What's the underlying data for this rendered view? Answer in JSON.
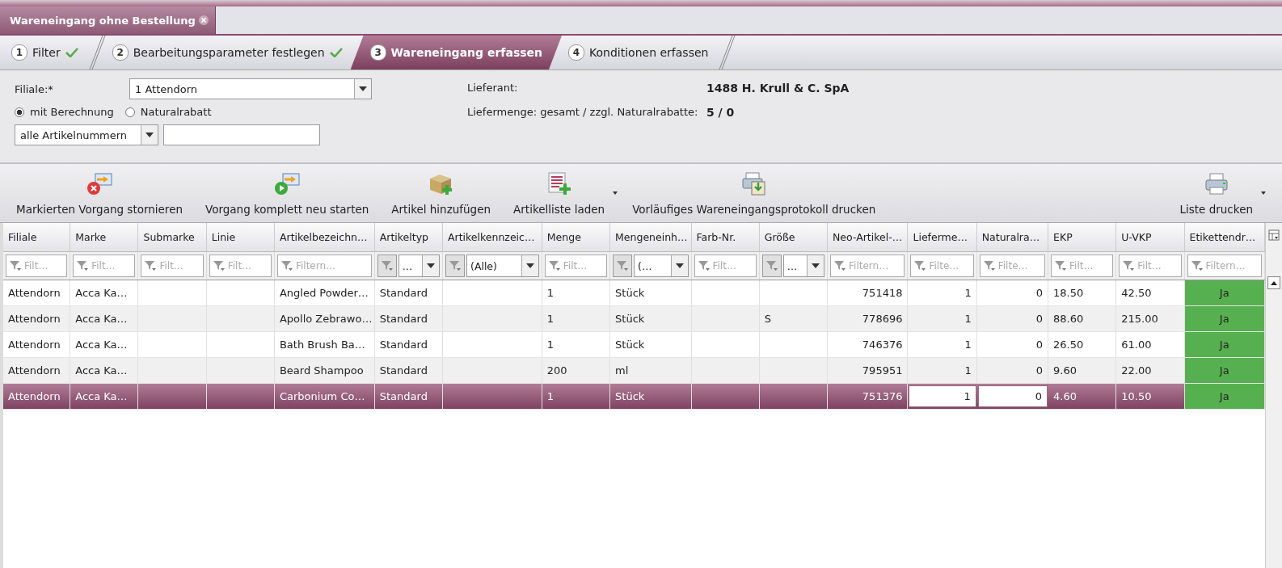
{
  "document_tab": {
    "title": "Wareneingang ohne Bestellung"
  },
  "steps": [
    {
      "number": "1",
      "label": "Filter",
      "done": true,
      "selected": false
    },
    {
      "number": "2",
      "label": "Bearbeitungsparameter festlegen",
      "done": true,
      "selected": false
    },
    {
      "number": "3",
      "label": "Wareneingang erfassen",
      "done": false,
      "selected": true
    },
    {
      "number": "4",
      "label": "Konditionen erfassen",
      "done": false,
      "selected": false
    }
  ],
  "form": {
    "filiale_label": "Filiale:*",
    "filiale_value": "1 Attendorn",
    "radios": [
      {
        "label": "mit Berechnung",
        "selected": true
      },
      {
        "label": "Naturalrabatt",
        "selected": false
      }
    ],
    "article_select": "alle Artikelnummern",
    "info": [
      {
        "label": "Lieferant:",
        "value": "1488 H. Krull & C. SpA"
      },
      {
        "label": "Liefermenge: gesamt / zzgl. Naturalrabatte:",
        "value": "5 / 0"
      }
    ]
  },
  "toolbar": [
    {
      "label": "Markierten Vorgang stornieren",
      "kind": "cancel",
      "dropdown": false
    },
    {
      "label": "Vorgang komplett neu starten",
      "kind": "restart",
      "dropdown": false
    },
    {
      "label": "Artikel hinzufügen",
      "kind": "box-add",
      "dropdown": false
    },
    {
      "label": "Artikelliste laden",
      "kind": "list-add",
      "dropdown": true
    },
    {
      "label": "Vorläufiges Wareneingangsprotokoll drucken",
      "kind": "print-doc",
      "dropdown": false
    },
    {
      "label": "Liste drucken",
      "kind": "print",
      "dropdown": true
    }
  ],
  "table": {
    "columns": [
      "Filiale",
      "Marke",
      "Submarke",
      "Linie",
      "Artikelbezeichn…",
      "Artikeltyp",
      "Artikelkennzeic…",
      "Menge",
      "Mengeneinh…",
      "Farb-Nr.",
      "Größe",
      "Neo-Artikel-…",
      "Lieferme…",
      "Naturalra…",
      "EKP",
      "U-VKP",
      "Etikettendr…"
    ],
    "filters": [
      {
        "kind": "text",
        "placeholder": "Filt…"
      },
      {
        "kind": "text",
        "placeholder": "Filt…"
      },
      {
        "kind": "text",
        "placeholder": "Filt…"
      },
      {
        "kind": "text",
        "placeholder": "Filt…"
      },
      {
        "kind": "text",
        "placeholder": "Filtern…"
      },
      {
        "kind": "select",
        "value": "…"
      },
      {
        "kind": "select",
        "value": "(Alle)"
      },
      {
        "kind": "text",
        "placeholder": "Filt…"
      },
      {
        "kind": "select",
        "value": "(…"
      },
      {
        "kind": "text",
        "placeholder": "Filt…"
      },
      {
        "kind": "select",
        "value": "…"
      },
      {
        "kind": "text",
        "placeholder": "Filtern…"
      },
      {
        "kind": "text",
        "placeholder": "Filte…"
      },
      {
        "kind": "text",
        "placeholder": "Filte…"
      },
      {
        "kind": "text",
        "placeholder": "Filt…"
      },
      {
        "kind": "text",
        "placeholder": "Filt…"
      },
      {
        "kind": "text",
        "placeholder": "Filtern…"
      }
    ],
    "rows": [
      {
        "selected": false,
        "cells": [
          "Attendorn",
          "Acca Ka…",
          "",
          "",
          "Angled Powder…",
          "Standard",
          "",
          "1",
          "Stück",
          "",
          "",
          "751418",
          "1",
          "0",
          "18.50",
          "42.50",
          "Ja"
        ]
      },
      {
        "selected": false,
        "cells": [
          "Attendorn",
          "Acca Ka…",
          "",
          "",
          "Apollo Zebrawo…",
          "Standard",
          "",
          "1",
          "Stück",
          "",
          "S",
          "778696",
          "1",
          "0",
          "88.60",
          "215.00",
          "Ja"
        ]
      },
      {
        "selected": false,
        "cells": [
          "Attendorn",
          "Acca Ka…",
          "",
          "",
          "Bath Brush Ba…",
          "Standard",
          "",
          "1",
          "Stück",
          "",
          "",
          "746376",
          "1",
          "0",
          "26.50",
          "61.00",
          "Ja"
        ]
      },
      {
        "selected": false,
        "cells": [
          "Attendorn",
          "Acca Ka…",
          "",
          "",
          "Beard Shampoo",
          "Standard",
          "",
          "200",
          "ml",
          "",
          "",
          "795951",
          "1",
          "0",
          "9.60",
          "22.00",
          "Ja"
        ]
      },
      {
        "selected": true,
        "cells": [
          "Attendorn",
          "Acca Ka…",
          "",
          "",
          "Carbonium Co…",
          "Standard",
          "",
          "1",
          "Stück",
          "",
          "",
          "751376",
          "1",
          "0",
          "4.60",
          "10.50",
          "Ja"
        ]
      }
    ]
  }
}
